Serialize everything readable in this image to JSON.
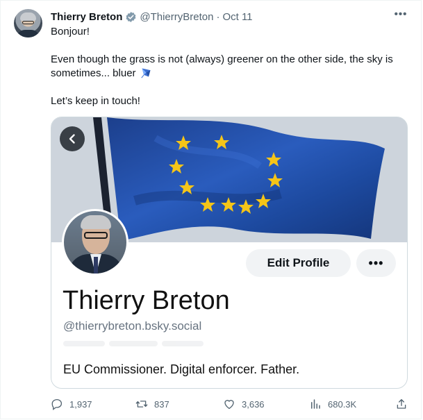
{
  "tweet": {
    "author_name": "Thierry Breton",
    "author_handle": "@ThierryBreton",
    "separator": "·",
    "date": "Oct 11",
    "more_label": "•••",
    "line1": "Bonjour!",
    "line2": "Even though the grass is not (always) greener on the other side, the sky is",
    "line3": "sometimes... bluer",
    "line4": "Let’s keep in touch!"
  },
  "card": {
    "edit_profile_label": "Edit Profile",
    "more_label": "•••",
    "profile_name": "Thierry Breton",
    "profile_handle": "@thierrybreton.bsky.social",
    "bio": "EU Commissioner. Digital enforcer. Father."
  },
  "actions": {
    "replies": "1,937",
    "reposts": "837",
    "likes": "3,636",
    "views": "680.3K"
  },
  "icons": {
    "verified": "verified-badge-icon",
    "more": "more-icon",
    "kite": "kite-emoji-icon",
    "back": "chevron-left-icon",
    "reply": "reply-icon",
    "repost": "repost-icon",
    "like": "heart-icon",
    "views": "views-chart-icon",
    "share": "share-icon"
  },
  "colors": {
    "text": "#0f1419",
    "muted": "#536471",
    "border": "#cfd9de",
    "flag_blue": "#1f4fa8",
    "star_yellow": "#f5c518"
  }
}
